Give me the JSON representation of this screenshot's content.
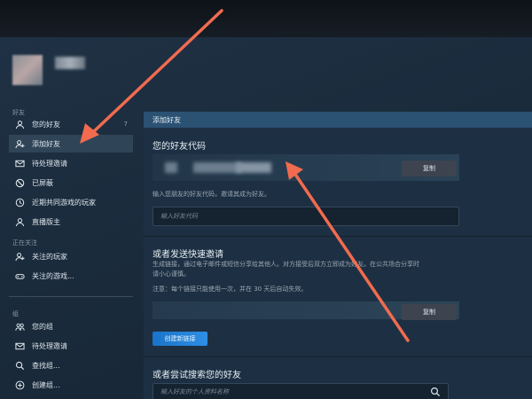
{
  "sidebar": {
    "friends_label": "好友",
    "friends_count": "7",
    "items_friends": [
      {
        "label": "您的好友",
        "icon": "person-icon"
      },
      {
        "label": "添加好友",
        "icon": "add-person-icon"
      },
      {
        "label": "待处理邀请",
        "icon": "mail-icon"
      },
      {
        "label": "已屏蔽",
        "icon": "block-icon"
      },
      {
        "label": "近期共同游戏的玩家",
        "icon": "clock-icon"
      },
      {
        "label": "直播版主",
        "icon": "person-icon"
      }
    ],
    "following_label": "正在关注",
    "items_following": [
      {
        "label": "关注的玩家",
        "icon": "add-person-icon"
      },
      {
        "label": "关注的游戏...",
        "icon": "gamepad-icon"
      }
    ],
    "groups_label": "组",
    "items_groups": [
      {
        "label": "您的组",
        "icon": "group-icon"
      },
      {
        "label": "待处理邀请",
        "icon": "mail-icon"
      },
      {
        "label": "查找组...",
        "icon": "search-icon"
      },
      {
        "label": "创建组...",
        "icon": "plus-icon"
      }
    ]
  },
  "panel": {
    "header": "添加好友",
    "code": {
      "title": "您的好友代码",
      "copy_label": "复制",
      "hint": "输入您朋友的好友代码，邀请其成为好友。",
      "input_placeholder": "输入好友代码"
    },
    "invite": {
      "title": "或者发送快速邀请",
      "desc1": "生成链接，通过电子邮件或短信分享给其他人。对方接受后双方立即成为好友。在公共场合分享时",
      "desc2": "请小心谨慎。",
      "note": "注意：每个链接只能使用一次，并在 30 天后自动失效。",
      "copy_label": "复制",
      "create_label": "创建新链接"
    },
    "search": {
      "title": "或者尝试搜索您的好友",
      "placeholder": "输入好友的个人资料名称"
    }
  },
  "colors": {
    "accent": "#2b5173",
    "button_blue": "#1a73c9",
    "annotation_arrow": "#f26b4f"
  }
}
